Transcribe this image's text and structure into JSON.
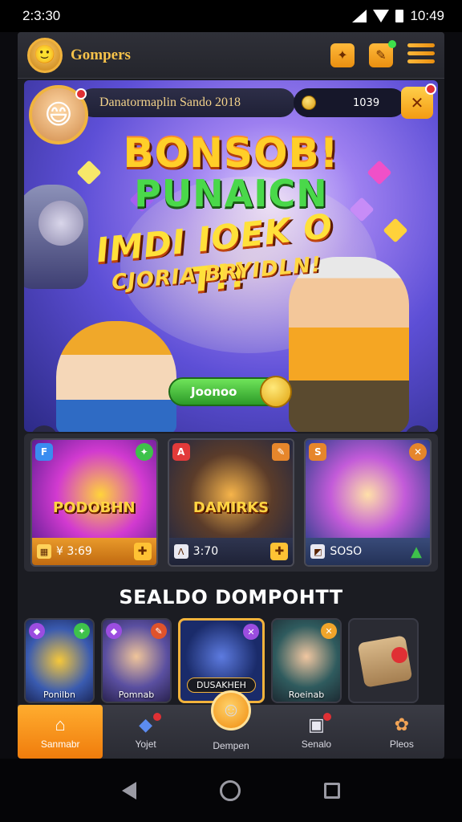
{
  "status_bar": {
    "time_left": "2:3:30",
    "time_right": "10:49"
  },
  "header": {
    "brand": "Gompers"
  },
  "banner": {
    "player_name": "Danatormaplin Sando 2018",
    "coins": "1039",
    "title_line1": "BONSOB!",
    "title_line2": "PUNAICN",
    "title_line3": "IMDI IOEK O T!!",
    "title_line4": "CJORIA BRYIDLN!",
    "play_label": "Joonoo"
  },
  "cards": [
    {
      "title": "PODOBHN",
      "tag_left": "F",
      "foot_value": "¥ 3:69",
      "accent": "#e99a2b"
    },
    {
      "title": "DAMIRKS",
      "tag_left": "A",
      "foot_value": "3:70",
      "accent": "#2f3550"
    },
    {
      "title": "",
      "tag_left": "S",
      "foot_value": "SOSO",
      "accent": "#394b7a"
    }
  ],
  "section": {
    "title": "SEALDO DOMPOHTT",
    "items": [
      {
        "label": "Ponilbn"
      },
      {
        "label": "Pomnab"
      },
      {
        "label": "DUSAKHEH"
      },
      {
        "label": "Roeinab"
      },
      {
        "label": ""
      }
    ]
  },
  "bottom_nav": [
    {
      "label": "Sanmabr",
      "icon": "home-icon"
    },
    {
      "label": "Yojet",
      "icon": "cube-icon"
    },
    {
      "label": "Dempen",
      "icon": "smile-icon"
    },
    {
      "label": "Senalo",
      "icon": "box-icon"
    },
    {
      "label": "Pleos",
      "icon": "tag-icon"
    }
  ]
}
